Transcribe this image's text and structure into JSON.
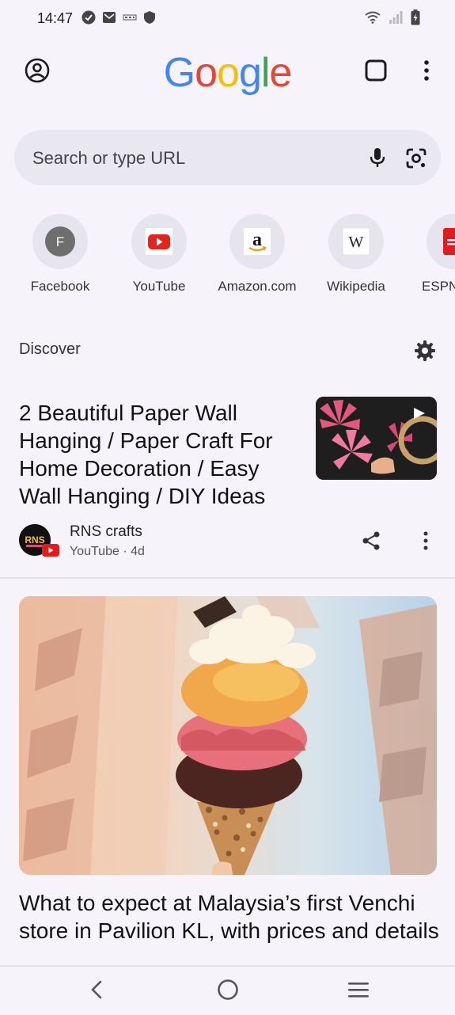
{
  "status": {
    "time": "14:47",
    "icons_left": [
      "check-circle-icon",
      "gmail-icon",
      "app-icon",
      "shield-icon"
    ],
    "icons_right": [
      "wifi-icon",
      "signal-icon",
      "battery-icon"
    ]
  },
  "header": {
    "logo_letters": [
      "G",
      "o",
      "o",
      "g",
      "l",
      "e"
    ],
    "logo_colors": [
      "#4285F4",
      "#EA4335",
      "#FBBC05",
      "#4285F4",
      "#34A853",
      "#EA4335"
    ]
  },
  "search": {
    "placeholder": "Search or type URL"
  },
  "shortcuts": [
    {
      "label": "Facebook",
      "icon": "facebook-letter-icon",
      "letter": "F"
    },
    {
      "label": "YouTube",
      "icon": "youtube-icon"
    },
    {
      "label": "Amazon.com",
      "icon": "amazon-icon",
      "letter": "a"
    },
    {
      "label": "Wikipedia",
      "icon": "wikipedia-icon",
      "letter": "W"
    },
    {
      "label": "ESPN",
      "icon": "espn-icon"
    }
  ],
  "discover": {
    "label": "Discover",
    "cards": [
      {
        "title": "2 Beautiful Paper Wall Hanging / Paper Craft For Home Decoration / Easy Wall Hanging / DIY Ideas",
        "source": "RNS crafts",
        "meta": "YouTube · 4d",
        "avatar_text": "RNS"
      },
      {
        "title": "What to expect at Malaysia’s first Venchi store in Pavilion KL, with prices and details"
      }
    ]
  }
}
